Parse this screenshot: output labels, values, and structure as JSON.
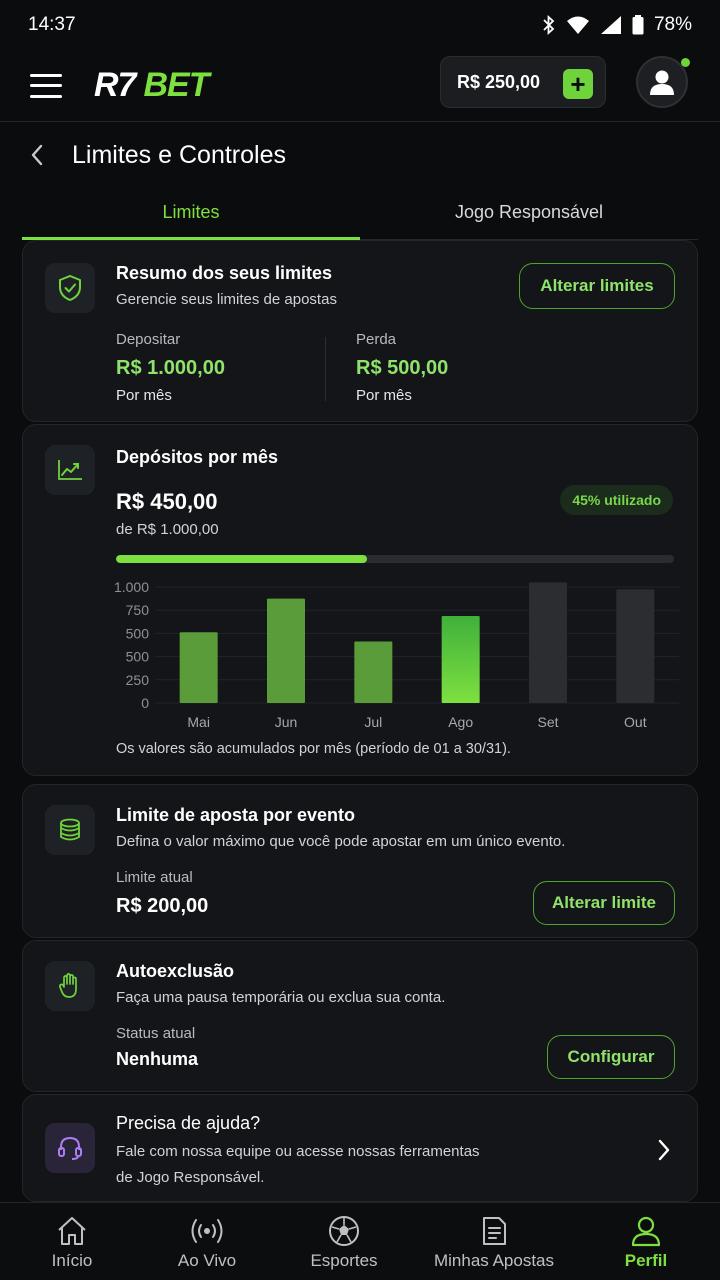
{
  "status": {
    "time": "14:37",
    "battery": "78%"
  },
  "header": {
    "logo_left": "R7",
    "logo_right": "BET",
    "balance": "R$ 250,00",
    "plus": "+"
  },
  "page": {
    "title": "Limites e Controles"
  },
  "tabs": [
    {
      "label": "Limites"
    },
    {
      "label": "Jogo Responsável"
    }
  ],
  "summary": {
    "title": "Resumo dos seus limites",
    "subtitle": "Gerencie seus limites de apostas",
    "button": "Alterar limites",
    "deposit_label": "Depositar",
    "deposit_value": "R$ 1.000,00",
    "deposit_period": "Por mês",
    "loss_label": "Perda",
    "loss_value": "R$ 500,00",
    "loss_period": "Por mês"
  },
  "deposits": {
    "title": "Depósitos por mês",
    "amount": "R$ 450,00",
    "of_limit": "de R$ 1.000,00",
    "badge": "45% utilizado",
    "progress": 0.45,
    "note": "Os valores são acumulados por mês (período de 01 a 30/31)."
  },
  "chart_data": {
    "type": "bar",
    "categories": [
      "Mai",
      "Jun",
      "Jul",
      "Ago",
      "Set",
      "Out"
    ],
    "values": [
      610,
      900,
      530,
      750,
      1040,
      980
    ],
    "ytick_labels": [
      "0",
      "250",
      "500",
      "500",
      "750",
      "1.000"
    ],
    "highlight": "Ago",
    "colors": {
      "past": "#5a9c3a",
      "current": "#6fd33b",
      "future": "#2b2d31"
    },
    "grid": true
  },
  "event_limit": {
    "title": "Limite de aposta por evento",
    "subtitle": "Defina o valor máximo que você pode apostar em um único evento.",
    "label": "Limite atual",
    "value": "R$ 200,00",
    "button": "Alterar limite"
  },
  "self_exclusion": {
    "title": "Autoexclusão",
    "subtitle": "Faça uma pausa temporária ou exclua sua conta.",
    "label": "Status atual",
    "value": "Nenhuma",
    "button": "Configurar"
  },
  "help": {
    "title": "Precisa de ajuda?",
    "line1": "Fale com nossa equipe ou acesse nossas ferramentas",
    "line2": "de Jogo Responsável."
  },
  "nav": [
    {
      "label": "Início",
      "icon": "home-icon"
    },
    {
      "label": "Ao Vivo",
      "icon": "live-icon"
    },
    {
      "label": "Esportes",
      "icon": "soccer-ball-icon"
    },
    {
      "label": "Minhas Apostas",
      "icon": "bets-icon"
    },
    {
      "label": "Perfil",
      "icon": "profile-icon"
    }
  ]
}
